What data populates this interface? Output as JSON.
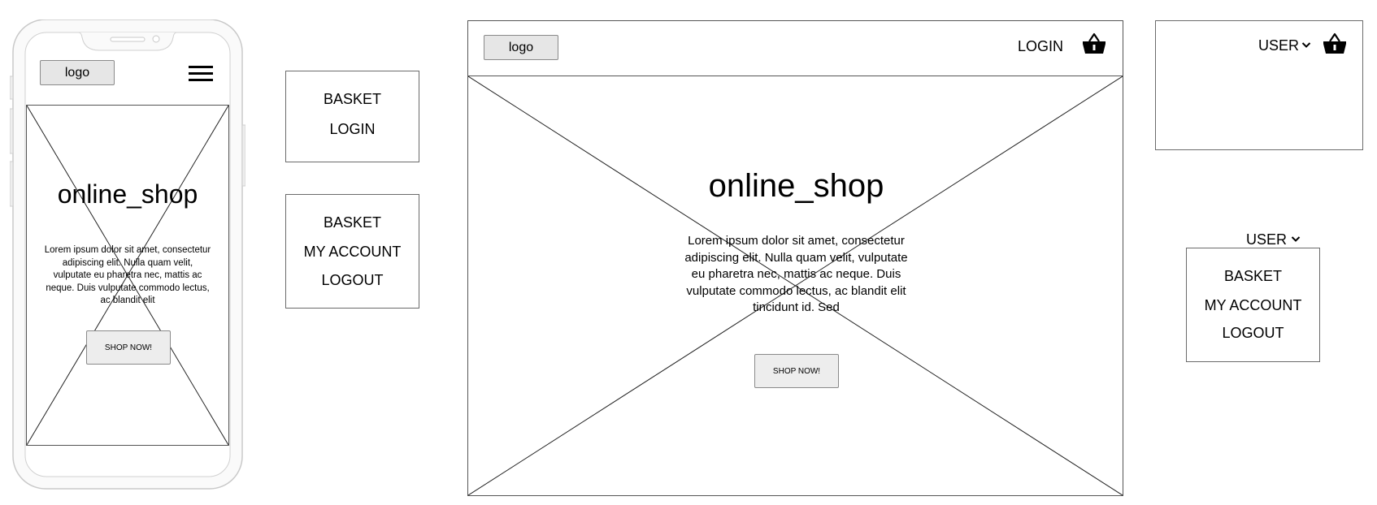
{
  "mobile": {
    "logo": "logo",
    "title": "online_shop",
    "body": "Lorem ipsum dolor sit amet, consectetur adipiscing elit. Nulla quam velit, vulputate eu pharetra nec, mattis ac neque. Duis vulputate commodo lectus, ac blandit elit",
    "button": "SHOP NOW!",
    "menu_icon": "hamburger-icon"
  },
  "mobile_menu_logged_out": {
    "items": [
      "BASKET",
      "LOGIN"
    ]
  },
  "mobile_menu_logged_in": {
    "items": [
      "BASKET",
      "MY ACCOUNT",
      "LOGOUT"
    ]
  },
  "desktop": {
    "logo": "logo",
    "login": "LOGIN",
    "title": "online_shop",
    "body": "Lorem ipsum dolor sit amet, consectetur adipiscing elit. Nulla quam velit, vulputate eu pharetra nec, mattis ac neque. Duis vulputate commodo lectus, ac blandit elit tincidunt id. Sed",
    "button": "SHOP NOW!",
    "basket_icon": "basket-icon"
  },
  "desktop_user_header": {
    "user": "USER",
    "chevron_icon": "chevron-down-icon",
    "basket_icon": "basket-icon"
  },
  "desktop_user_dropdown": {
    "user": "USER",
    "items": [
      "BASKET",
      "MY ACCOUNT",
      "LOGOUT"
    ]
  }
}
